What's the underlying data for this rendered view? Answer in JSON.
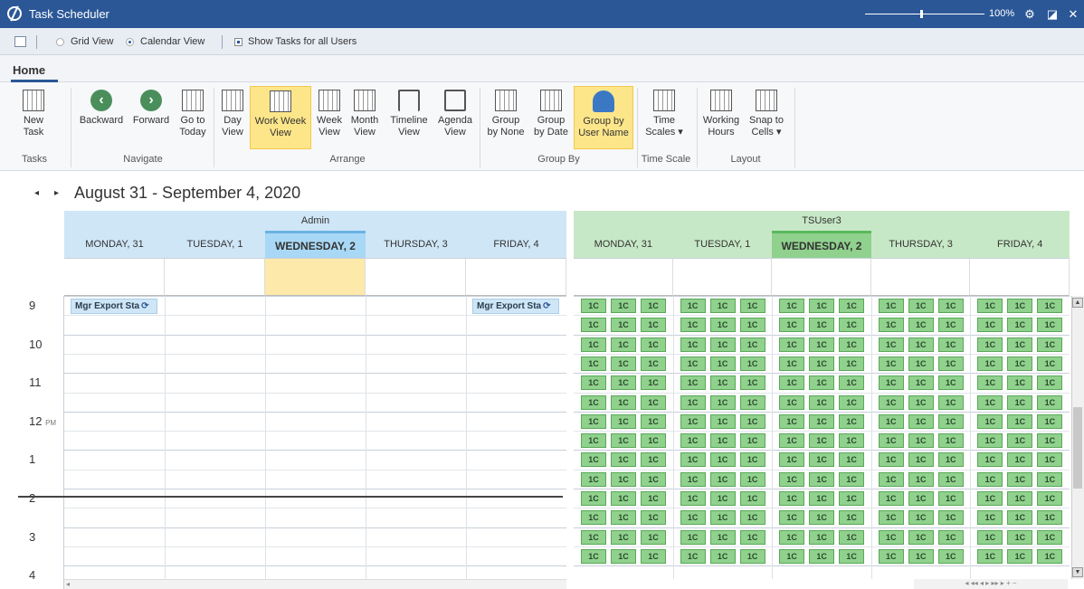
{
  "window": {
    "title": "Task Scheduler",
    "zoom": "100%"
  },
  "qat": {
    "grid_view": "Grid View",
    "calendar_view": "Calendar View",
    "show_all": "Show Tasks for all Users",
    "view_mode": "Calendar View",
    "show_all_checked": true
  },
  "tabs": {
    "home": "Home"
  },
  "ribbon": {
    "new_task": "New Task",
    "backward": "Backward",
    "forward": "Forward",
    "go_to_today_1": "Go to",
    "go_to_today_2": "Today",
    "day_view_1": "Day",
    "day_view_2": "View",
    "work_week_1": "Work Week",
    "work_week_2": "View",
    "week_1": "Week",
    "week_2": "View",
    "month_1": "Month",
    "month_2": "View",
    "timeline_1": "Timeline",
    "timeline_2": "View",
    "agenda_1": "Agenda",
    "agenda_2": "View",
    "group_none_1": "Group",
    "group_none_2": "by None",
    "group_date_1": "Group",
    "group_date_2": "by Date",
    "group_user_1": "Group by",
    "group_user_2": "User Name",
    "time_scales_1": "Time",
    "time_scales_2": "Scales ▾",
    "working_hours_1": "Working",
    "working_hours_2": "Hours",
    "snap_1": "Snap to",
    "snap_2": "Cells ▾",
    "groups": {
      "tasks": "Tasks",
      "navigate": "Navigate",
      "arrange": "Arrange",
      "group_by": "Group By",
      "time_scale": "Time Scale",
      "layout": "Layout"
    }
  },
  "calendar": {
    "date_range": "August 31 - September 4, 2020",
    "resources": [
      "Admin",
      "TSUser3"
    ],
    "days": [
      "MONDAY, 31",
      "TUESDAY, 1",
      "WEDNESDAY, 2",
      "THURSDAY, 3",
      "FRIDAY, 4"
    ],
    "today_index": 2,
    "hours": [
      "9",
      "10",
      "11",
      "12",
      "1",
      "2",
      "3",
      "4"
    ],
    "pm_label": "PM",
    "appointments": [
      "Mgr Export Sta",
      "Mgr Export Sta"
    ],
    "ts_cell_glyph": "1C"
  },
  "colors": {
    "titlebar": "#2b5797",
    "admin": "#cfe6f7",
    "tsuser": "#c7e8c6",
    "today_allday": "#fde9a9",
    "task_cell": "#8fd18d"
  }
}
